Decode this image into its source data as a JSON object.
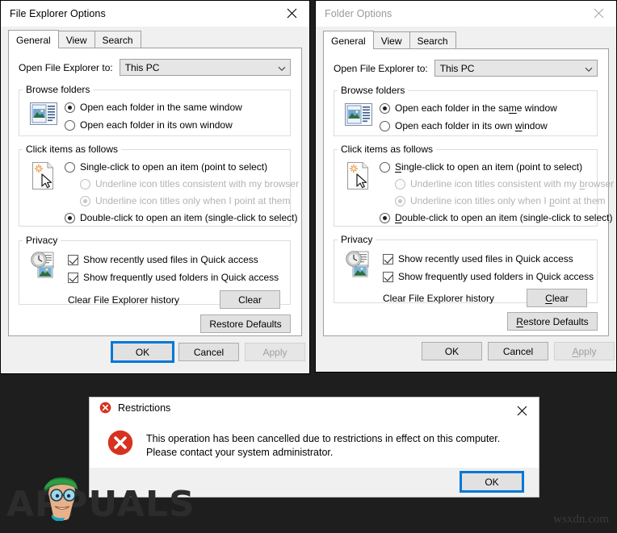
{
  "desktop": {
    "background_color": "#1e1e1e",
    "watermark_left": "APPUALS",
    "watermark_right": "wsxdn.com"
  },
  "window1": {
    "title": "File Explorer Options",
    "close_icon": "close-icon",
    "state": "active",
    "tabs": [
      {
        "label": "General",
        "selected": true
      },
      {
        "label": "View",
        "selected": false
      },
      {
        "label": "Search",
        "selected": false
      }
    ],
    "open_to": {
      "label": "Open File Explorer to:",
      "value": "This PC",
      "caret_icon": "chevron-down-icon"
    },
    "browse_folders": {
      "legend": "Browse folders",
      "icon": "browse-folders-icon",
      "options": [
        {
          "label": "Open each folder in the same window",
          "selected": true
        },
        {
          "label": "Open each folder in its own window",
          "selected": false
        }
      ]
    },
    "click_items": {
      "legend": "Click items as follows",
      "icon": "click-items-icon",
      "options": [
        {
          "label": "Single-click to open an item (point to select)",
          "selected": false,
          "disabled": false
        },
        {
          "label": "Underline icon titles consistent with my browser",
          "selected": false,
          "disabled": true
        },
        {
          "label": "Underline icon titles only when I point at them",
          "selected": true,
          "disabled": true
        },
        {
          "label": "Double-click to open an item (single-click to select)",
          "selected": true,
          "disabled": false
        }
      ]
    },
    "privacy": {
      "legend": "Privacy",
      "icon": "privacy-history-icon",
      "checkboxes": [
        {
          "label": "Show recently used files in Quick access",
          "checked": true
        },
        {
          "label": "Show frequently used folders in Quick access",
          "checked": true
        }
      ],
      "clear_label": "Clear File Explorer history",
      "clear_button": "Clear"
    },
    "restore_defaults": "Restore Defaults",
    "footer": {
      "ok": "OK",
      "cancel": "Cancel",
      "apply": "Apply",
      "apply_disabled": true,
      "ok_focused": true
    }
  },
  "window2": {
    "title": "Folder Options",
    "close_icon": "close-icon",
    "state": "inactive",
    "tabs": [
      {
        "label": "General",
        "selected": true
      },
      {
        "label": "View",
        "selected": false
      },
      {
        "label": "Search",
        "selected": false
      }
    ],
    "open_to": {
      "label": "Open File Explorer to:",
      "value": "This PC",
      "caret_icon": "chevron-down-icon"
    },
    "browse_folders": {
      "legend": "Browse folders",
      "icon": "browse-folders-icon",
      "options": [
        {
          "label_a": "Open each folder in the sa",
          "label_key": "m",
          "label_b": "e window",
          "selected": true
        },
        {
          "label_a": "Open each folder in its own ",
          "label_key": "w",
          "label_b": "indow",
          "selected": false
        }
      ]
    },
    "click_items": {
      "legend": "Click items as follows",
      "icon": "click-items-icon",
      "options": [
        {
          "label_a": "",
          "label_key": "S",
          "label_b": "ingle-click to open an item (point to select)",
          "selected": false,
          "disabled": false
        },
        {
          "label_a": "Underline icon titles consistent with my ",
          "label_key": "b",
          "label_b": "rowser",
          "selected": false,
          "disabled": true
        },
        {
          "label_a": "Underline icon titles only when I ",
          "label_key": "p",
          "label_b": "oint at them",
          "selected": true,
          "disabled": true
        },
        {
          "label_a": "",
          "label_key": "D",
          "label_b": "ouble-click to open an item (single-click to select)",
          "selected": true,
          "disabled": false
        }
      ]
    },
    "privacy": {
      "legend": "Privacy",
      "icon": "privacy-history-icon",
      "checkboxes": [
        {
          "label": "Show recently used files in Quick access",
          "checked": true
        },
        {
          "label": "Show frequently used folders in Quick access",
          "checked": true
        }
      ],
      "clear_label": "Clear File Explorer history",
      "clear_button_key": "C",
      "clear_button_rest": "lear"
    },
    "restore_defaults_key": "R",
    "restore_defaults_rest": "estore Defaults",
    "footer": {
      "ok": "OK",
      "cancel": "Cancel",
      "apply_key": "A",
      "apply_rest": "pply",
      "apply_disabled": true,
      "ok_focused": false
    }
  },
  "dialog": {
    "title": "Restrictions",
    "title_icon": "error-circle-icon",
    "close_icon": "close-icon",
    "body_icon": "error-circle-large-icon",
    "message": "This operation has been cancelled due to restrictions in effect on this computer. Please contact your system administrator.",
    "ok_button": "OK",
    "ok_focused": true,
    "accent_color": "#d0021b",
    "focus_color": "#0078d7"
  }
}
